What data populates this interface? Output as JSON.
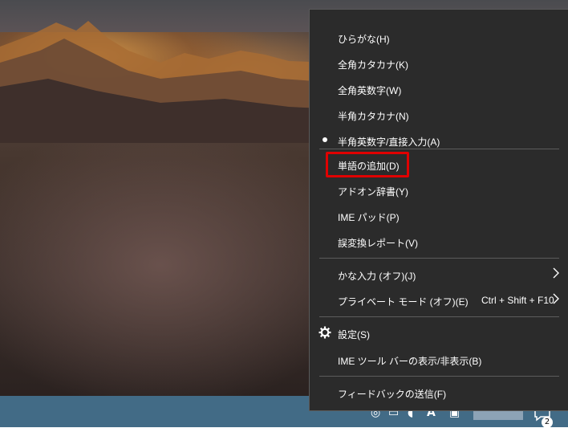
{
  "menu": {
    "items": [
      {
        "label": "ひらがな(H)"
      },
      {
        "label": "全角カタカナ(K)"
      },
      {
        "label": "全角英数字(W)"
      },
      {
        "label": "半角カタカナ(N)"
      },
      {
        "label": "半角英数字/直接入力(A)",
        "selected": true
      },
      {
        "label": "単語の追加(D)",
        "highlighted": true
      },
      {
        "label": "アドオン辞書(Y)"
      },
      {
        "label": "IME パッド(P)"
      },
      {
        "label": "誤変換レポート(V)"
      },
      {
        "label": "かな入力 (オフ)(J)",
        "submenu": true
      },
      {
        "label": "プライベート モード (オフ)(E)",
        "accelerator": "Ctrl + Shift + F10",
        "submenu": true
      },
      {
        "label": "設定(S)",
        "icon": "gear-icon"
      },
      {
        "label": "IME ツール バーの表示/非表示(B)"
      },
      {
        "label": "フィードバックの送信(F)"
      }
    ]
  },
  "taskbar": {
    "tray_glyph": "A",
    "notification_count": "2"
  },
  "colors": {
    "menu_background": "#2b2b2b",
    "menu_text": "#ffffff",
    "highlight_box": "#e00000",
    "taskbar": "#426b86"
  }
}
